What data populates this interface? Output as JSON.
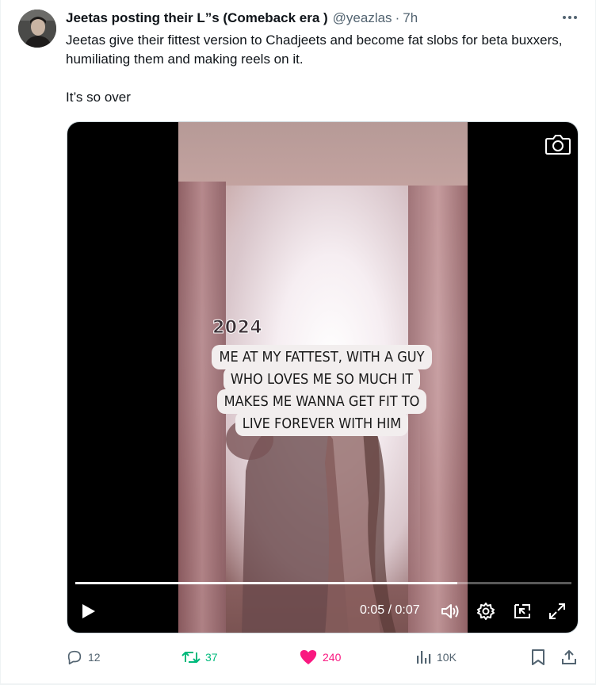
{
  "tweet": {
    "display_name": "Jeetas posting their L”s (Comeback era )",
    "handle": "@yeazlas",
    "separator": "·",
    "time": "7h",
    "text_line1": "Jeetas give their fittest version to Chadjeets and become fat slobs for beta buxxers, humiliating them and making reels on it.",
    "text_line2": "It’s so over"
  },
  "video": {
    "caption_year": "2024",
    "caption_lines": [
      "ME AT MY FATTEST, WITH A GUY",
      "WHO LOVES ME SO MUCH IT",
      "MAKES ME WANNA GET FIT TO",
      "LIVE FOREVER WITH HIM"
    ],
    "timecode": "0:05 / 0:07",
    "progress": 0.77
  },
  "actions": {
    "replies": "12",
    "reposts": "37",
    "likes": "240",
    "views": "10K"
  },
  "colors": {
    "text_primary": "#0f1419",
    "text_secondary": "#536471",
    "repost_green": "#00ba7c",
    "like_pink": "#f91880",
    "border": "#eff3f4"
  },
  "icons": [
    "more-icon",
    "camera-icon",
    "play-icon",
    "volume-icon",
    "settings-icon",
    "pip-icon",
    "fullscreen-icon",
    "reply-icon",
    "repost-icon",
    "like-icon",
    "views-icon",
    "bookmark-icon",
    "share-icon"
  ]
}
